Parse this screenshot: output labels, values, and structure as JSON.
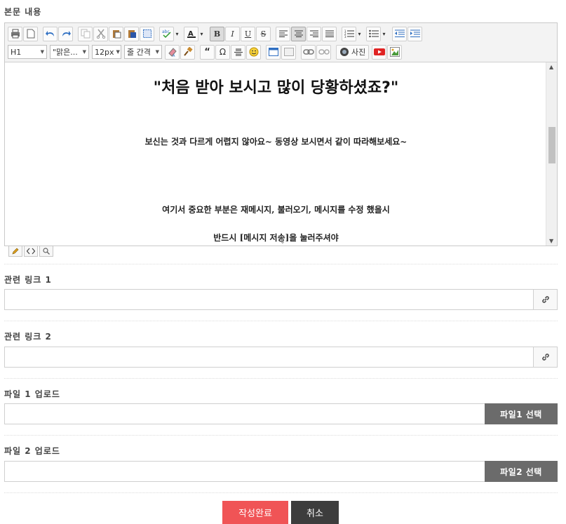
{
  "labels": {
    "body_content": "본문 내용",
    "related_link_1": "관련 링크 1",
    "related_link_2": "관련 링크 2",
    "file_upload_1": "파일 1 업로드",
    "file_upload_2": "파일 2 업로드"
  },
  "toolbar": {
    "heading_select": "H1",
    "font_select": "\"맑은...",
    "size_select": "12px",
    "line_height_select": "줄 간격",
    "quote_glyph": "“",
    "omega_glyph": "Ω",
    "bold_glyph": "B",
    "italic_glyph": "I",
    "underline_glyph": "U",
    "strike_glyph": "S",
    "photo_label": "사진"
  },
  "editor": {
    "headline": "\"처음 받아 보시고 많이 당황하셨죠?\"",
    "para1": "보신는 것과 다르게 어렵지 않아요~ 동영상 보시면서 같이 따라해보세요~",
    "para2": "여기서 중요한 부분은  재메시지, 불러오기, 메시지를 수정 했을시",
    "para3": "반드시 [메시지 저송]을 눌러주셔야"
  },
  "inputs": {
    "link1_value": "",
    "link2_value": "",
    "file1_value": "",
    "file2_value": ""
  },
  "buttons": {
    "file1_select": "파일1 선택",
    "file2_select": "파일2 선택",
    "submit": "작성완료",
    "cancel": "취소"
  },
  "colors": {
    "submit_bg": "#f05456",
    "cancel_bg": "#3d3d3d",
    "file_btn_bg": "#6b6b6b"
  }
}
